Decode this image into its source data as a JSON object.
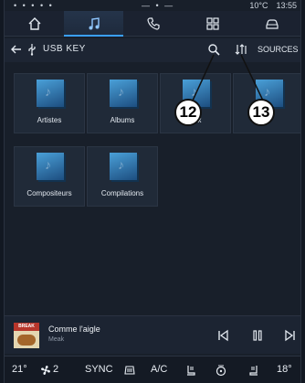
{
  "status": {
    "left_icons": "• • • • •",
    "center": "— • —",
    "temperature": "10°C",
    "time": "13:55"
  },
  "nav": {
    "tabs": [
      {
        "name": "home-icon",
        "active": false
      },
      {
        "name": "music-icon",
        "active": true
      },
      {
        "name": "phone-icon",
        "active": false
      },
      {
        "name": "apps-icon",
        "active": false
      },
      {
        "name": "car-icon",
        "active": false
      }
    ]
  },
  "header": {
    "title": "USB KEY",
    "sources": "SOURCES"
  },
  "tiles": [
    {
      "label": "Artistes"
    },
    {
      "label": "Albums"
    },
    {
      "label": "ux"
    },
    {
      "label": ""
    },
    {
      "label": "Compositeurs"
    },
    {
      "label": "Compilations"
    }
  ],
  "callouts": {
    "search": "12",
    "sort": "13"
  },
  "player": {
    "song": "Comme l'aigle",
    "artist": "Meak",
    "cover_text": "BREAK"
  },
  "climate": {
    "left_temp": "21°",
    "fan": "2",
    "sync": "SYNC",
    "ac": "A/C",
    "right_temp": "18°"
  }
}
